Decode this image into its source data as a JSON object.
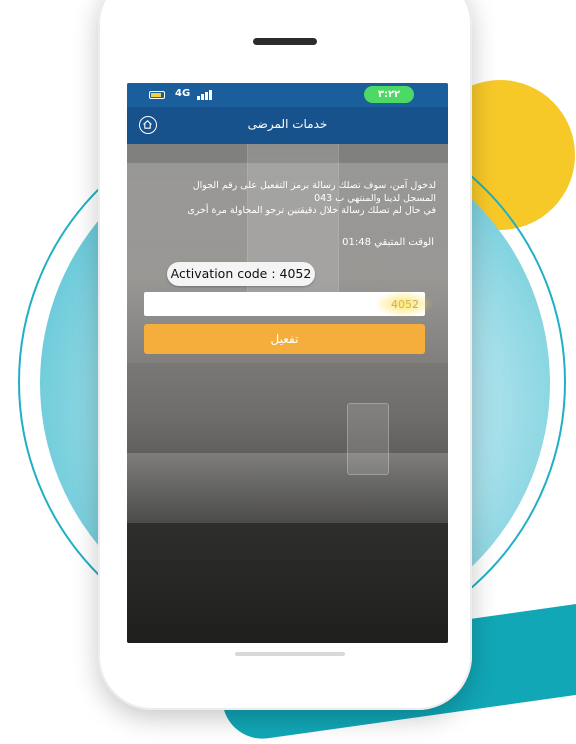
{
  "status_bar": {
    "network": "4G",
    "time": "٣:٢٢",
    "battery_level": 0.8
  },
  "app_bar": {
    "title": "خدمات المرضى",
    "home_icon": "home-icon"
  },
  "activation": {
    "message_line1": "لدخول آمن، سوف تصلك رسالة برمز التفعيل على رقم الجوال",
    "message_line2": "المسجل لدينا والمنتهي ب 043",
    "message_line3": "في حال لم تصلك رسالة خلال دقيقتين ترجو المحاولة مرة أخرى",
    "remaining_label": "الوقت المتبقي",
    "remaining_time": "01:48",
    "code_bubble": "Activation code : 4052",
    "code_value": "4052",
    "activate_button": "تفعيل"
  },
  "colors": {
    "status_bar": "#1b5e9c",
    "app_bar": "#17528d",
    "button": "#f5ae3c",
    "accent_teal": "#1fb0c4",
    "accent_yellow": "#f7c928"
  }
}
